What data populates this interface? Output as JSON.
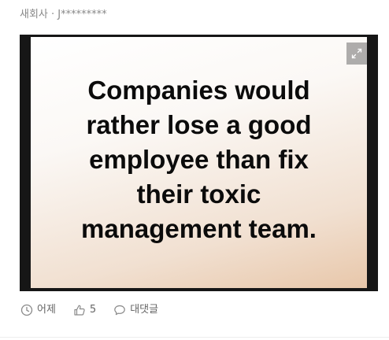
{
  "post": {
    "header": "새회사 · J*********",
    "image": {
      "quote_lines": [
        "Companies would",
        "rather lose a good",
        "employee than fix",
        "their toxic",
        "management team."
      ],
      "expand_icon": "expand-icon"
    },
    "meta": {
      "time_icon": "clock-icon",
      "time": "어제",
      "like_icon": "thumbs-up-icon",
      "likes": "5",
      "comment_icon": "comment-icon",
      "comment_label": "대댓글"
    }
  }
}
